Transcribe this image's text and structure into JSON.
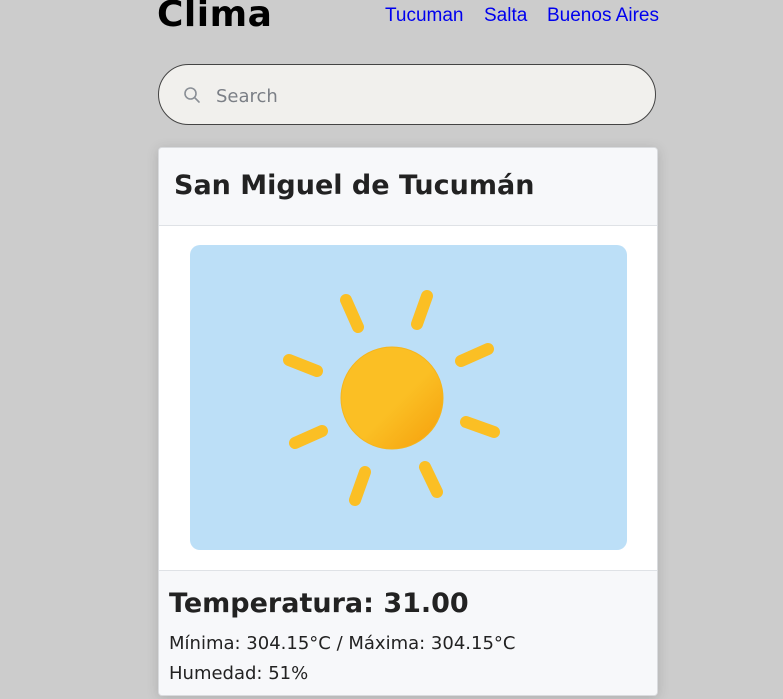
{
  "header": {
    "title": "Clima"
  },
  "nav": {
    "links": [
      "Tucuman",
      "Salta",
      "Buenos Aires"
    ]
  },
  "search": {
    "placeholder": "Search",
    "value": ""
  },
  "card": {
    "city": "San Miguel de Tucumán",
    "weather_icon": "sun-icon",
    "temperature_text": "Temperatura: 31.00",
    "minmax_text": "Mínima: 304.15°C / Máxima: 304.15°C",
    "humidity_text": "Humedad: 51%"
  },
  "colors": {
    "background": "#cccccc",
    "link": "#0000ee",
    "image_bg": "#bcdff7",
    "sun": "#fbbf24",
    "sun_dark": "#f59e0b"
  }
}
